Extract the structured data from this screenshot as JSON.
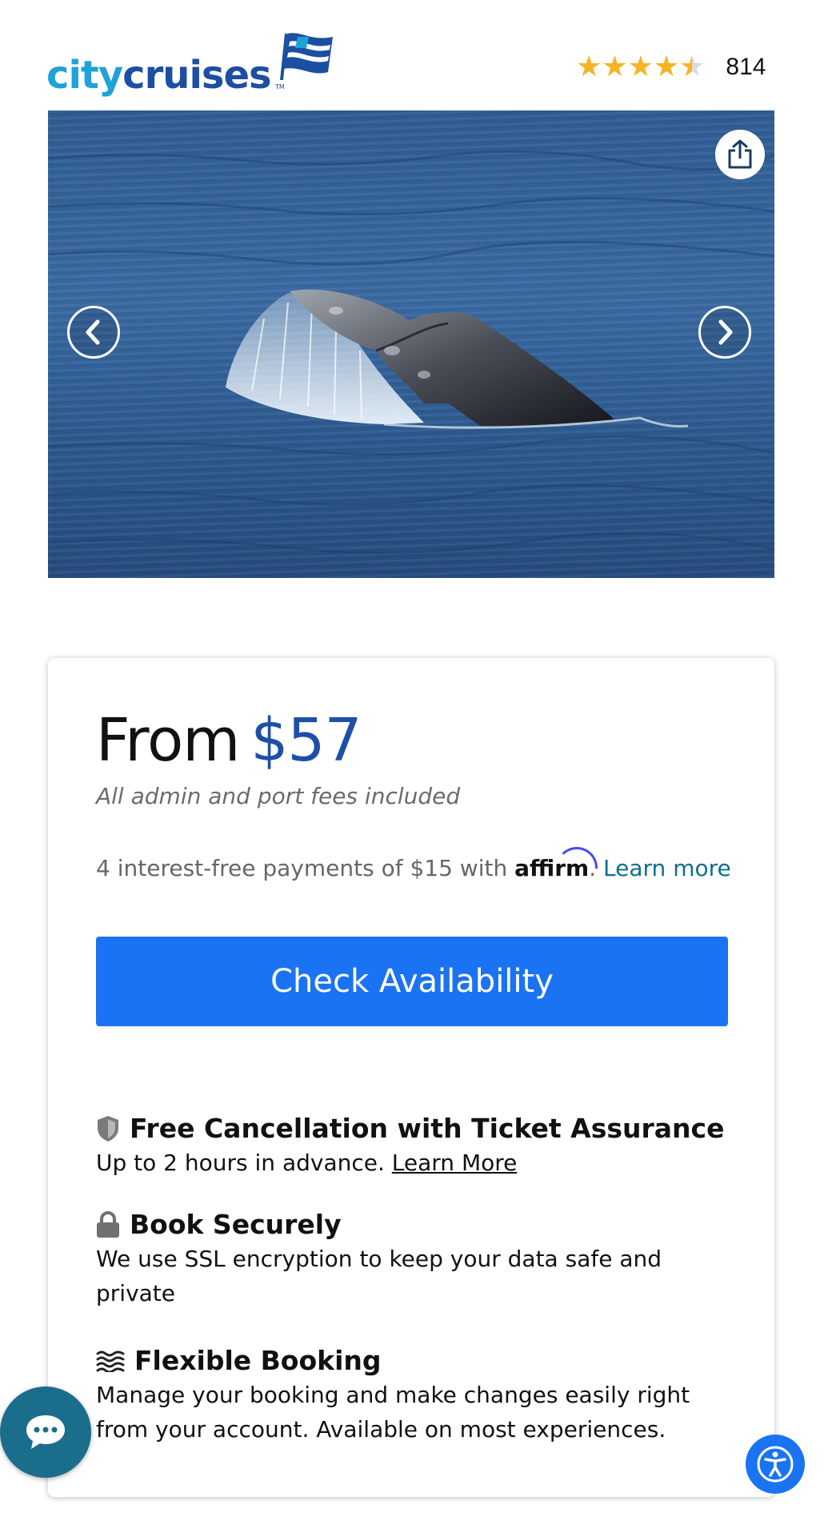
{
  "brand": {
    "logo_part1": "city",
    "logo_part2": "cruises",
    "trademark": "TM",
    "colors": {
      "city": "#1fa2d8",
      "cruises": "#1c4fa2"
    }
  },
  "rating": {
    "stars": 4.5,
    "max": 5,
    "count": "814"
  },
  "hero": {
    "share_icon": "share-icon",
    "prev_icon": "chevron-left-icon",
    "next_icon": "chevron-right-icon"
  },
  "booking": {
    "from_label": "From",
    "price": "$57",
    "fees_note": "All admin and port fees included",
    "affirm_text": "4 interest-free payments of $15 with",
    "affirm_brand": "affirm",
    "affirm_dot": ".",
    "affirm_link": "Learn more",
    "cta_label": "Check Availability",
    "colors": {
      "price": "#1e4fa8",
      "cta": "#1a73f2"
    }
  },
  "features": [
    {
      "icon": "shield-icon",
      "title": "Free Cancellation with Ticket Assurance",
      "desc": "Up to 2 hours in advance.",
      "link": "Learn More"
    },
    {
      "icon": "lock-icon",
      "title": "Book Securely",
      "desc": "We use SSL encryption to keep your data safe and private"
    },
    {
      "icon": "waves-icon",
      "title": "Flexible Booking",
      "desc": "Manage your booking and make changes easily right from your account. Available on most experiences."
    }
  ],
  "floating": {
    "chat_icon": "chat-icon",
    "accessibility_icon": "accessibility-icon"
  }
}
